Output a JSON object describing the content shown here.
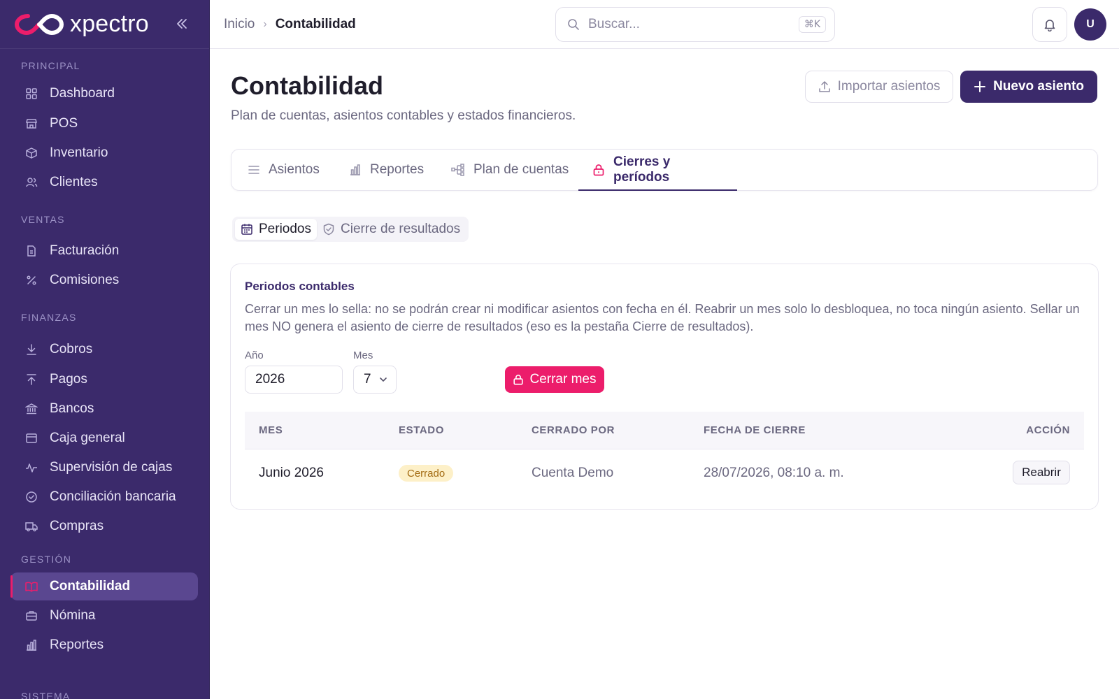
{
  "brand": {
    "name": "xpectro"
  },
  "sidebar": {
    "sections": [
      {
        "label": "PRINCIPAL"
      },
      {
        "label": "VENTAS"
      },
      {
        "label": "FINANZAS"
      },
      {
        "label": "GESTIÓN"
      },
      {
        "label": "SISTEMA"
      }
    ],
    "items": [
      {
        "label": "Dashboard",
        "icon": "grid-icon"
      },
      {
        "label": "POS",
        "icon": "store-icon"
      },
      {
        "label": "Inventario",
        "icon": "box-icon"
      },
      {
        "label": "Clientes",
        "icon": "users-icon"
      },
      {
        "label": "Facturación",
        "icon": "document-icon"
      },
      {
        "label": "Comisiones",
        "icon": "percent-icon"
      },
      {
        "label": "Cobros",
        "icon": "arrow-down-icon"
      },
      {
        "label": "Pagos",
        "icon": "arrow-up-icon"
      },
      {
        "label": "Bancos",
        "icon": "bank-icon"
      },
      {
        "label": "Caja general",
        "icon": "cash-box-icon"
      },
      {
        "label": "Supervisión de cajas",
        "icon": "activity-icon"
      },
      {
        "label": "Conciliación bancaria",
        "icon": "check-circle-icon"
      },
      {
        "label": "Compras",
        "icon": "truck-icon"
      },
      {
        "label": "Contabilidad",
        "icon": "book-icon",
        "active": true
      },
      {
        "label": "Nómina",
        "icon": "briefcase-icon"
      },
      {
        "label": "Reportes",
        "icon": "bar-chart-icon"
      }
    ]
  },
  "topbar": {
    "breadcrumb": {
      "home": "Inicio",
      "current": "Contabilidad"
    },
    "search": {
      "placeholder": "Buscar...",
      "shortcut": "⌘K"
    },
    "avatar_initial": "U"
  },
  "header": {
    "title": "Contabilidad",
    "subtitle": "Plan de cuentas, asientos contables y estados financieros.",
    "import_label": "Importar asientos",
    "new_label": "Nuevo asiento"
  },
  "tabs": [
    {
      "label": "Asientos",
      "icon": "list-icon"
    },
    {
      "label": "Reportes",
      "icon": "bar-chart-icon"
    },
    {
      "label": "Plan de cuentas",
      "icon": "hierarchy-icon"
    },
    {
      "label": "Cierres y períodos",
      "icon": "lock-icon",
      "active": true
    }
  ],
  "subtabs": [
    {
      "label": "Periodos",
      "icon": "calendar-icon",
      "active": true
    },
    {
      "label": "Cierre de resultados",
      "icon": "shield-check-icon"
    }
  ],
  "periods": {
    "title": "Periodos contables",
    "description": "Cerrar un mes lo sella: no se podrán crear ni modificar asientos con fecha en él. Reabrir un mes solo lo desbloquea, no toca ningún asiento. Sellar un mes NO genera el asiento de cierre de resultados (eso es la pestaña Cierre de resultados).",
    "year_label": "Año",
    "year_value": "2026",
    "month_label": "Mes",
    "month_value": "7",
    "close_label": "Cerrar mes",
    "columns": {
      "month": "MES",
      "status": "ESTADO",
      "closed_by": "CERRADO POR",
      "closed_at": "FECHA DE CIERRE",
      "action": "ACCIÓN"
    },
    "rows": [
      {
        "month": "Junio 2026",
        "status": "Cerrado",
        "closed_by": "Cuenta Demo",
        "closed_at": "28/07/2026, 08:10 a. m.",
        "action": "Reabrir"
      }
    ]
  },
  "colors": {
    "primary": "#3b2a6b",
    "accent": "#ec1d6b",
    "badge_bg": "#fdf0c8",
    "badge_text": "#a36b12"
  }
}
